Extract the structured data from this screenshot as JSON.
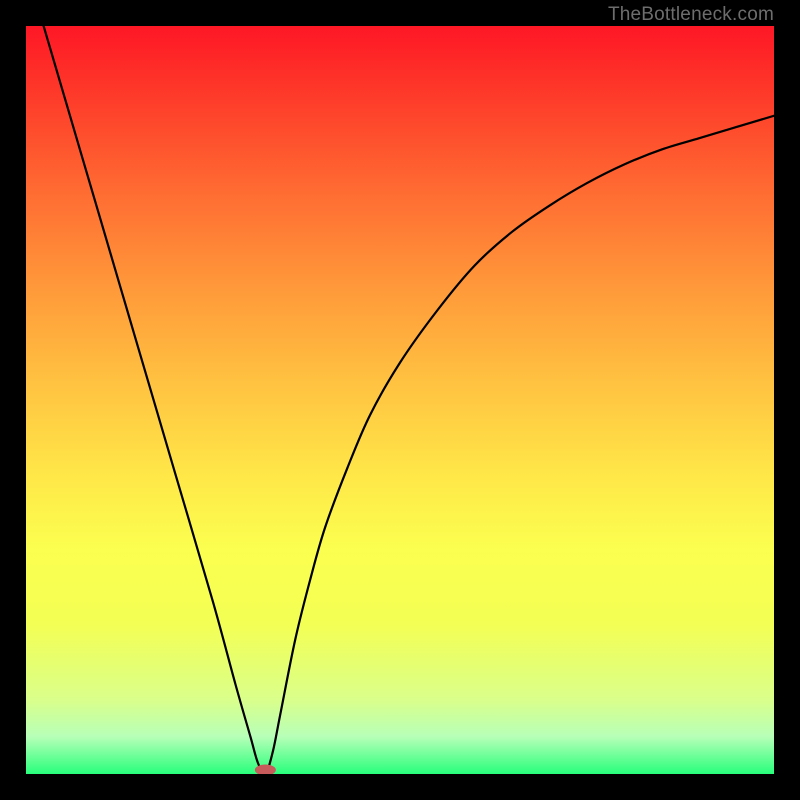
{
  "watermark": "TheBottleneck.com",
  "chart_data": {
    "type": "line",
    "title": "",
    "xlabel": "",
    "ylabel": "",
    "xlim": [
      0,
      100
    ],
    "ylim": [
      0,
      100
    ],
    "grid": false,
    "legend": false,
    "series": [
      {
        "name": "bottleneck-curve",
        "x": [
          0,
          5,
          10,
          15,
          20,
          25,
          28,
          30,
          31,
          32,
          33,
          34,
          36,
          38,
          40,
          43,
          46,
          50,
          55,
          60,
          65,
          70,
          75,
          80,
          85,
          90,
          95,
          100
        ],
        "values": [
          108,
          91,
          74,
          57,
          40,
          23,
          12,
          5,
          1.5,
          0,
          3,
          8,
          18,
          26,
          33,
          41,
          48,
          55,
          62,
          68,
          72.5,
          76,
          79,
          81.5,
          83.5,
          85,
          86.5,
          88
        ]
      }
    ],
    "annotations": [
      {
        "name": "optimal-point",
        "x": 32,
        "y": 0,
        "shape": "pill",
        "color": "#c75a5a"
      }
    ],
    "background": {
      "type": "vertical-gradient",
      "stops": [
        {
          "pos": 0.0,
          "color": "#fe1725"
        },
        {
          "pos": 0.5,
          "color": "#ffe748"
        },
        {
          "pos": 0.95,
          "color": "#b7ffb8"
        },
        {
          "pos": 1.0,
          "color": "#28ff7b"
        }
      ]
    }
  }
}
